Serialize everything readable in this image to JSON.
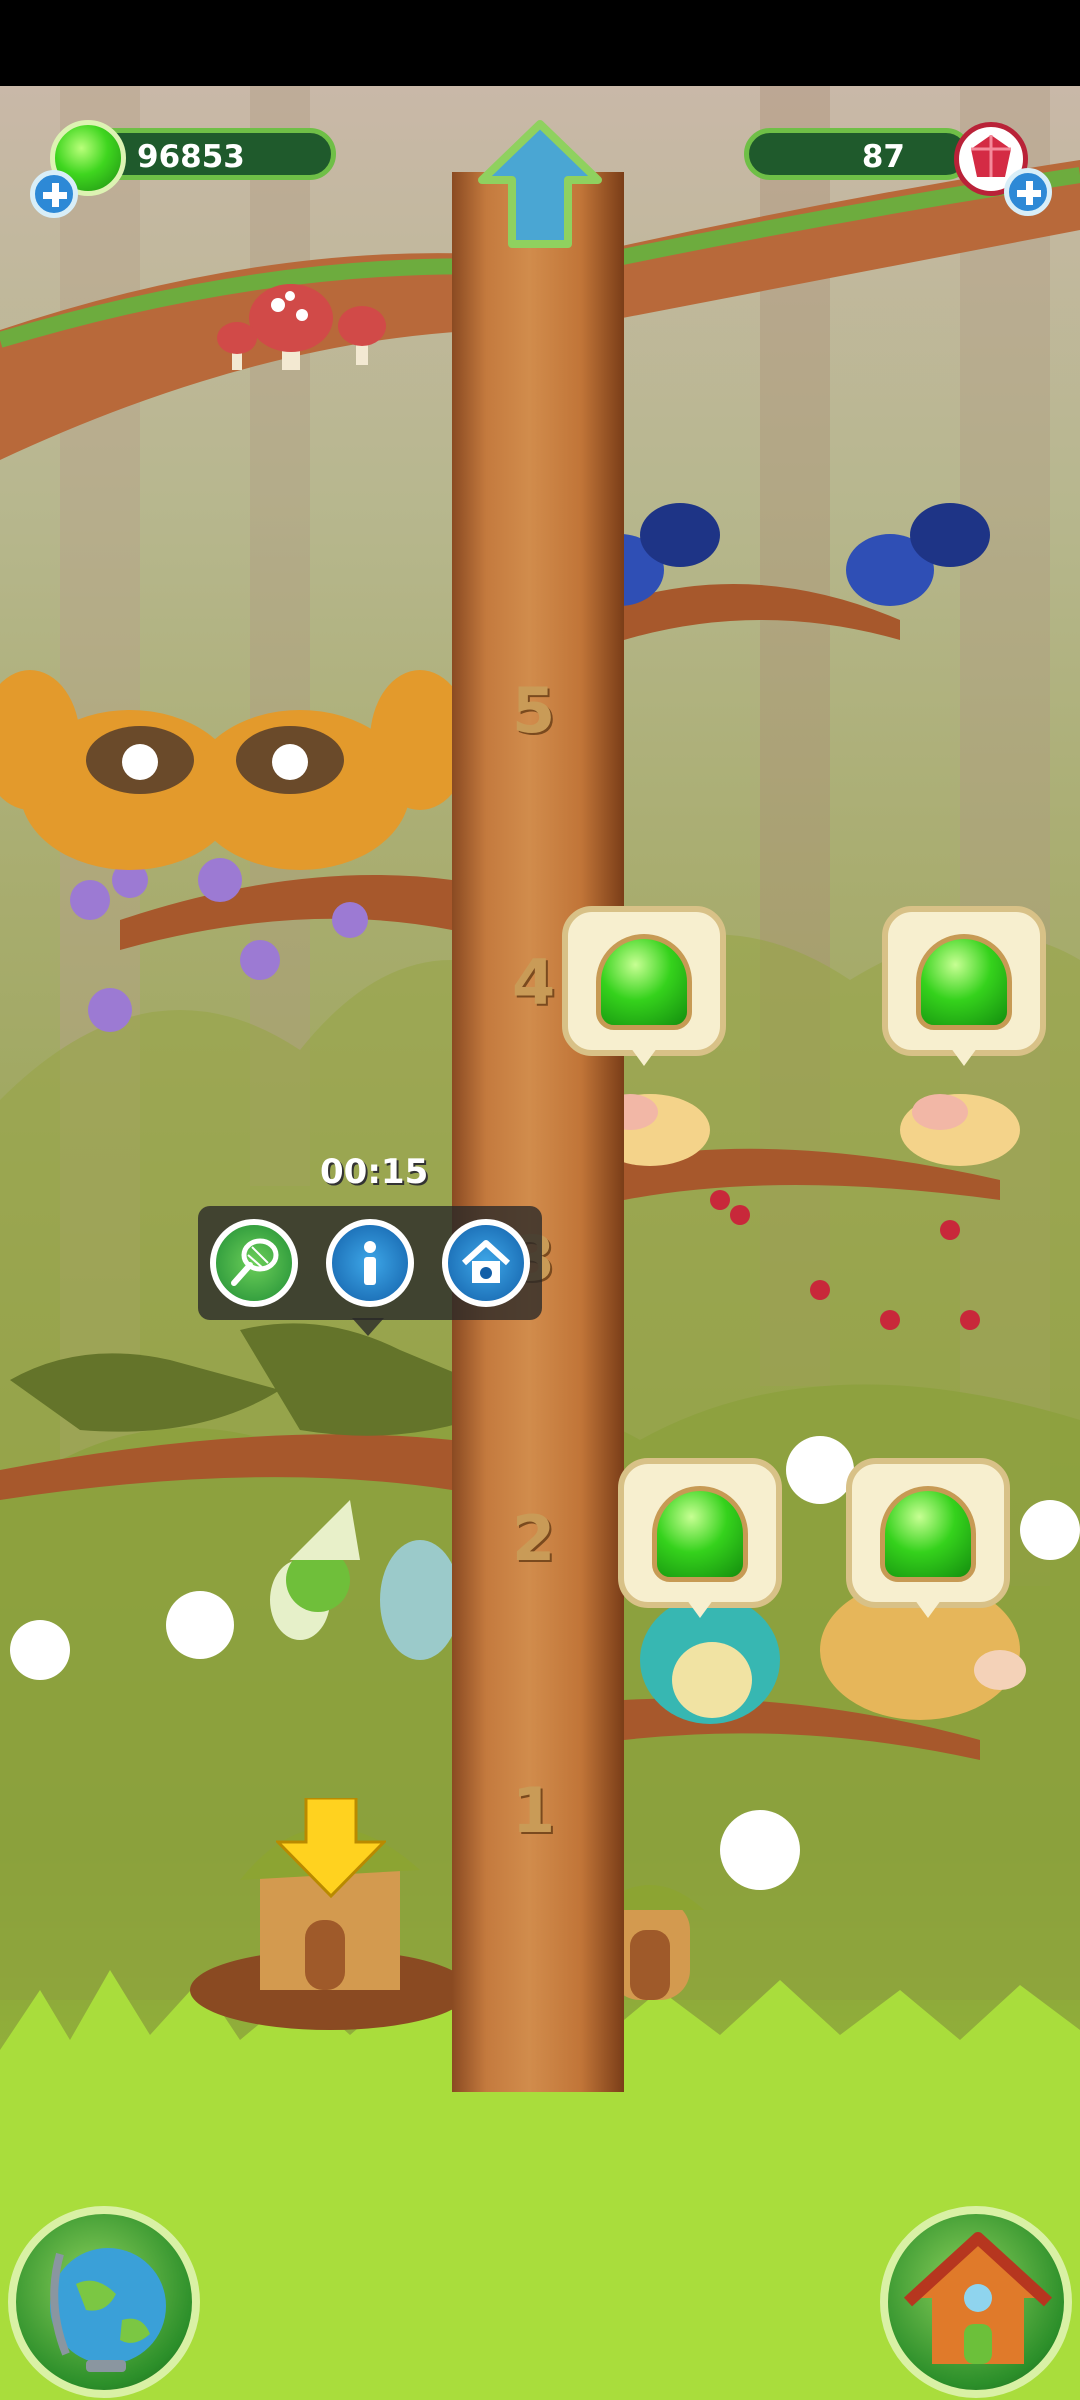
{
  "hud": {
    "gel_count": "96853",
    "gem_count": "87",
    "gel_icon": "green-gel-icon",
    "gem_icon": "red-gem-icon",
    "up_icon": "up-arrow-icon"
  },
  "tree": {
    "level_labels": [
      "5",
      "4",
      "3",
      "2",
      "1"
    ]
  },
  "timer": "00:15",
  "action_bar": {
    "icons": [
      "net-icon",
      "info-icon",
      "pet-house-icon"
    ]
  },
  "bottom": {
    "left_icon": "globe-icon",
    "right_icon": "house-icon"
  },
  "colors": {
    "gel_green": "#35d21c",
    "hud_bar": "#1f5a2c",
    "gem_red": "#b92238",
    "plus_blue": "#2d89d6",
    "grass": "#bde43f"
  }
}
